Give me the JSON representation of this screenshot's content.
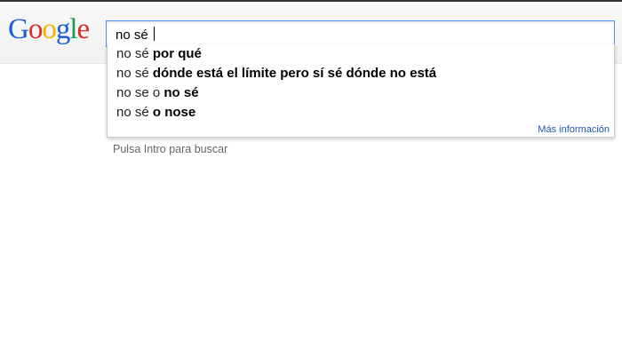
{
  "logo": {
    "letters": [
      {
        "char": "G",
        "color": "#1a5fd6"
      },
      {
        "char": "o",
        "color": "#d93025"
      },
      {
        "char": "o",
        "color": "#f4b400"
      },
      {
        "char": "g",
        "color": "#1a5fd6"
      },
      {
        "char": "l",
        "color": "#179c52"
      },
      {
        "char": "e",
        "color": "#d93025"
      }
    ]
  },
  "search": {
    "value": "no sé "
  },
  "suggestions": [
    {
      "prefix": "no sé ",
      "completion": "por qué"
    },
    {
      "prefix": "no sé ",
      "completion": "dónde está el límite pero sí sé dónde no está"
    },
    {
      "prefix": "no se o ",
      "completion": "no sé"
    },
    {
      "prefix": "no sé ",
      "completion": "o nose"
    }
  ],
  "more_info_label": "Más información",
  "hint": "Pulsa Intro para buscar"
}
